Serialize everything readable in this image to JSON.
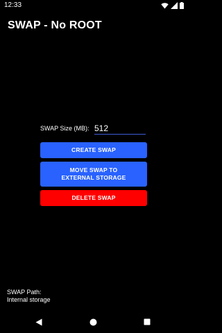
{
  "status_bar": {
    "time": "12:33",
    "icons": [
      "wifi-icon",
      "signal-icon",
      "battery-icon"
    ]
  },
  "app": {
    "title": "SWAP - No ROOT"
  },
  "swap_size": {
    "label": "SWAP Size (MB):",
    "value": "512"
  },
  "buttons": {
    "create": "CREATE SWAP",
    "move_line1": "MOVE SWAP TO",
    "move_line2": "EXTERNAL STORAGE",
    "delete": "DELETE SWAP"
  },
  "swap_path": {
    "label": "SWAP Path:",
    "value": "Internal storage"
  },
  "nav_bar": {
    "icons": [
      "back-icon",
      "home-icon",
      "recents-icon"
    ]
  },
  "colors": {
    "background": "#000000",
    "primary_button": "#2962ff",
    "delete_button": "#ff0000",
    "input_underline": "#3b5bd6"
  }
}
